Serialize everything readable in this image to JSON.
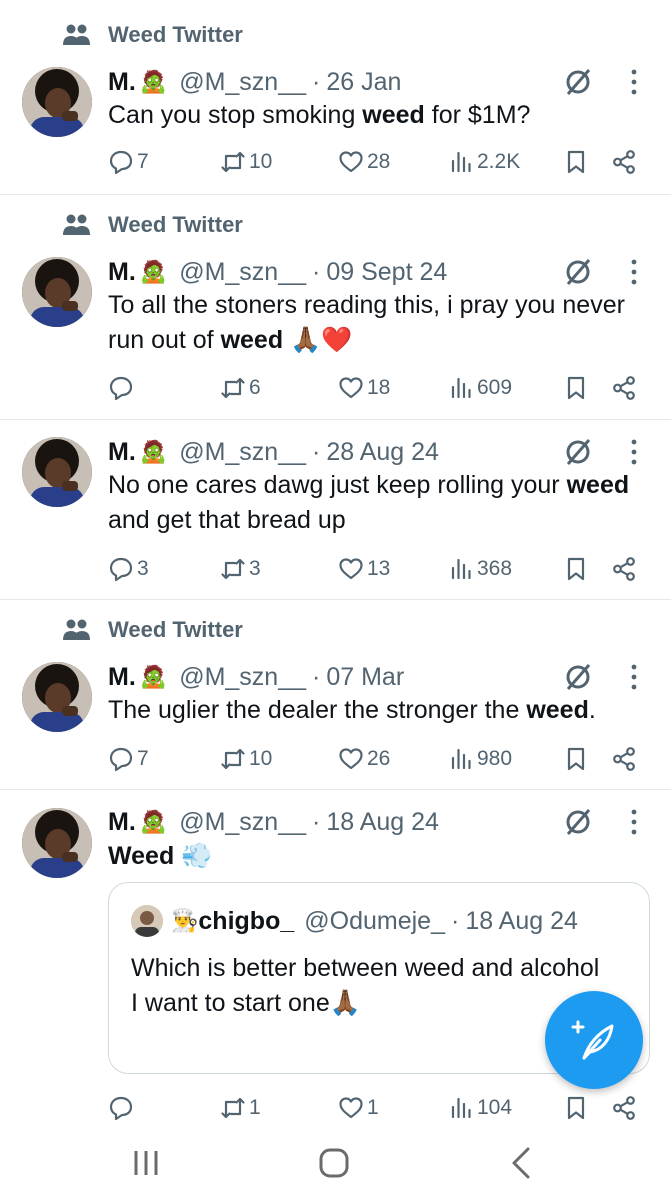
{
  "colors": {
    "accent": "#1d9bf0",
    "secondary_text": "#536471",
    "primary_text": "#0f1419"
  },
  "tweets": [
    {
      "community": "Weed Twitter",
      "name": "M.",
      "emoji": "🧟",
      "handle": "@M_szn__",
      "date": "26 Jan",
      "text_before": "Can you stop smoking ",
      "text_bold": "weed",
      "text_after": " for $1M?",
      "replies": "7",
      "reposts": "10",
      "likes": "28",
      "views": "2.2K"
    },
    {
      "community": "Weed Twitter",
      "name": "M.",
      "emoji": "🧟",
      "handle": "@M_szn__",
      "date": "09 Sept 24",
      "text_before": "To all the stoners reading this, i pray you never run out of ",
      "text_bold": "weed",
      "text_after": " 🙏🏾❤️",
      "replies": "",
      "reposts": "6",
      "likes": "18",
      "views": "609"
    },
    {
      "community": "",
      "name": "M.",
      "emoji": "🧟",
      "handle": "@M_szn__",
      "date": "28 Aug 24",
      "text_before": "No one cares dawg just keep rolling your ",
      "text_bold": "weed",
      "text_after": " and get that bread up",
      "replies": "3",
      "reposts": "3",
      "likes": "13",
      "views": "368"
    },
    {
      "community": "Weed Twitter",
      "name": "M.",
      "emoji": "🧟",
      "handle": "@M_szn__",
      "date": "07 Mar",
      "text_before": "The uglier the dealer the stronger the ",
      "text_bold": "weed",
      "text_after": ".",
      "replies": "7",
      "reposts": "10",
      "likes": "26",
      "views": "980"
    },
    {
      "community": "",
      "name": "M.",
      "emoji": "🧟",
      "handle": "@M_szn__",
      "date": "18 Aug 24",
      "text_before": "",
      "text_bold": "Weed",
      "text_after": " 💨",
      "replies": "",
      "reposts": "1",
      "likes": "1",
      "views": "104",
      "quote": {
        "emoji": "👨‍🍳",
        "name": "chigbo_",
        "handle": "@Odumeje_",
        "date": "18 Aug 24",
        "text": "Which is better between weed and alcohol\nI want to start one🙏🏾"
      }
    }
  ],
  "icons": {
    "community": "community-people-icon",
    "grok": "grok-icon",
    "more": "more-vertical-icon",
    "reply": "reply-icon",
    "repost": "repost-icon",
    "like": "heart-icon",
    "views": "views-icon",
    "bookmark": "bookmark-icon",
    "share": "share-icon",
    "fab": "compose-post-icon"
  }
}
